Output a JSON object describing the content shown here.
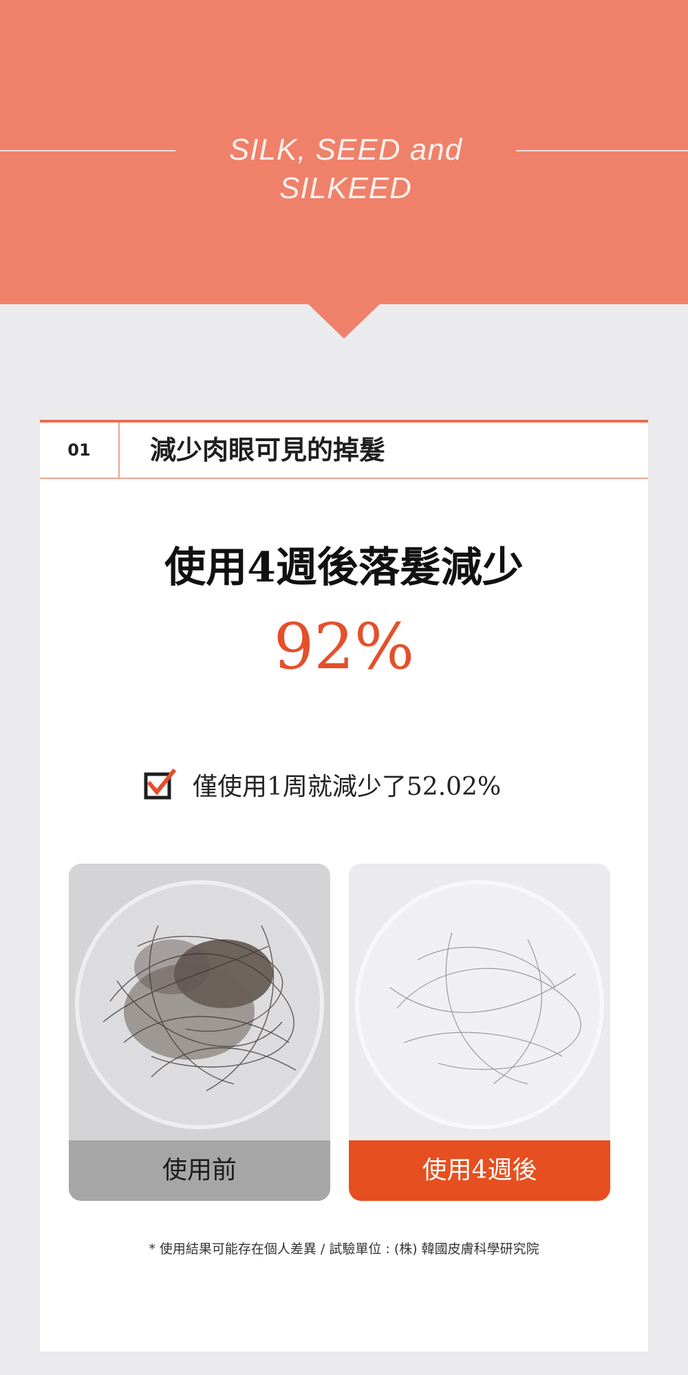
{
  "hero": {
    "title": "SILK, SEED and SILKEED",
    "background_color": "#ef816a"
  },
  "section": {
    "number": "01",
    "title": "減少肉眼可見的掉髮",
    "accent_color": "#ec6d4c"
  },
  "result": {
    "headline": "使用4週後落髮減少",
    "percent": "92%",
    "percent_color": "#e4502a"
  },
  "note": {
    "icon": "checkbox-checked-icon",
    "text": "僅使用1周就減少了52.02%"
  },
  "comparison": {
    "before_label": "使用前",
    "after_label": "使用4週後",
    "before_label_color": "#a6a6a6",
    "after_label_color": "#e64f1f"
  },
  "footnote": "* 使用結果可能存在個人差異 / 試驗單位 : (株) 韓國皮膚科學研究院"
}
